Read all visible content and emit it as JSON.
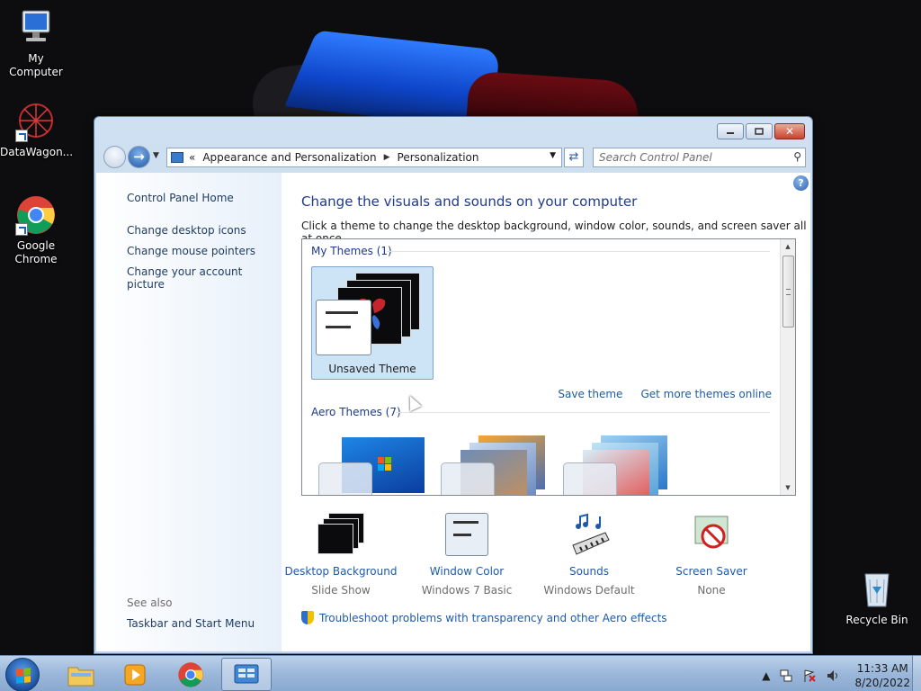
{
  "desktop": {
    "icons": [
      {
        "label": "My Computer"
      },
      {
        "label": "DataWagon..."
      },
      {
        "label": "Google Chrome"
      },
      {
        "label": "Recycle Bin"
      }
    ]
  },
  "window": {
    "address": {
      "overflow": "«",
      "crumb1": "Appearance and Personalization",
      "crumb2": "Personalization"
    },
    "search": {
      "placeholder": "Search Control Panel"
    },
    "left_pane": {
      "home": "Control Panel Home",
      "links": [
        "Change desktop icons",
        "Change mouse pointers",
        "Change your account picture"
      ],
      "see_also_label": "See also",
      "see_also_links": [
        "Taskbar and Start Menu"
      ]
    },
    "main": {
      "heading": "Change the visuals and sounds on your computer",
      "subtext": "Click a theme to change the desktop background, window color, sounds, and screen saver all at once.",
      "my_themes_label": "My Themes (1)",
      "unsaved_theme": "Unsaved Theme",
      "save_theme": "Save theme",
      "get_more": "Get more themes online",
      "aero_label": "Aero Themes (7)",
      "bottom": [
        {
          "title": "Desktop Background",
          "value": "Slide Show"
        },
        {
          "title": "Window Color",
          "value": "Windows 7 Basic"
        },
        {
          "title": "Sounds",
          "value": "Windows Default"
        },
        {
          "title": "Screen Saver",
          "value": "None"
        }
      ],
      "troubleshoot": "Troubleshoot problems with transparency and other Aero effects"
    }
  },
  "taskbar": {
    "clock_time": "11:33 AM",
    "clock_date": "8/20/2022"
  },
  "colors": {
    "link": "#1e5aa8",
    "heading": "#1e3a8a",
    "selected_tile": "#cde4f7"
  }
}
